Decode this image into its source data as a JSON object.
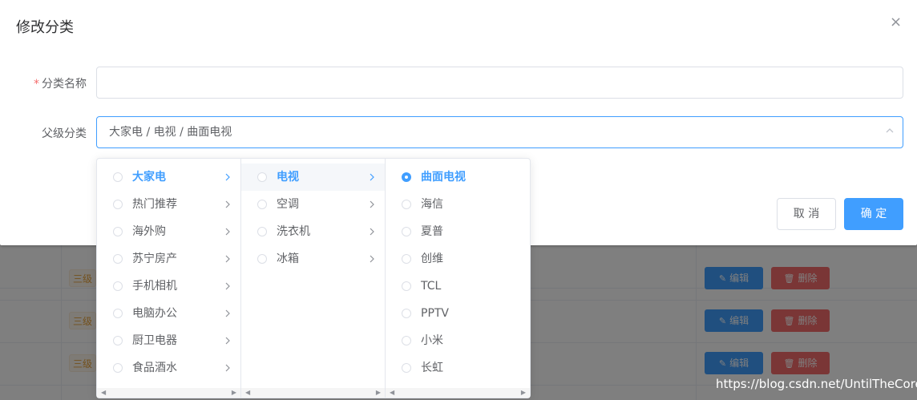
{
  "dialog": {
    "title": "修改分类",
    "close_label": "×",
    "fields": {
      "name_required_mark": "*",
      "name_label": "分类名称",
      "name_value": "",
      "parent_label": "父级分类",
      "parent_value": "大家电 / 电视 / 曲面电视"
    },
    "cancel_label": "取 消",
    "confirm_label": "确 定"
  },
  "cascader": {
    "level1": [
      "大家电",
      "热门推荐",
      "海外购",
      "苏宁房产",
      "手机相机",
      "电脑办公",
      "厨卫电器",
      "食品酒水"
    ],
    "level2": [
      "电视",
      "空调",
      "洗衣机",
      "冰箱"
    ],
    "level3": [
      "曲面电视",
      "海信",
      "夏普",
      "创维",
      "TCL",
      "PPTV",
      "小米",
      "长虹"
    ],
    "selected_level1": "大家电",
    "selected_level2": "电视",
    "selected_level3": "曲面电视"
  },
  "background_table": {
    "rows": [
      {
        "level": "三级",
        "edit_label": "编辑",
        "delete_label": "删除"
      },
      {
        "level": "三级",
        "edit_label": "编辑",
        "delete_label": "删除"
      },
      {
        "level": "三级",
        "edit_label": "编辑",
        "delete_label": "删除"
      }
    ]
  },
  "watermark": "https://blog.csdn.net/UntilTheCore",
  "colors": {
    "primary": "#409eff",
    "danger": "#f56c6c",
    "warning": "#e6a23c"
  }
}
